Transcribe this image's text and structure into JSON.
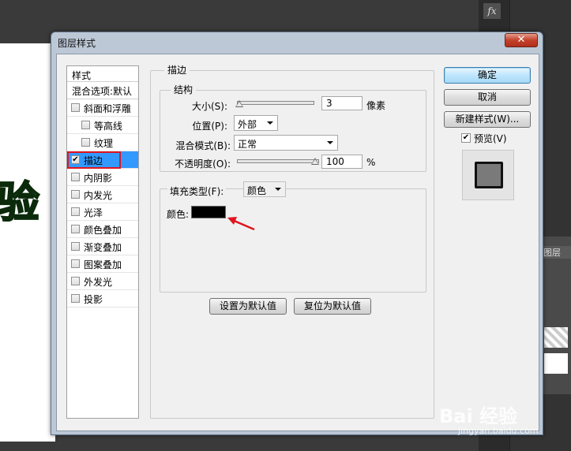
{
  "background": {
    "canvas_text": "验",
    "fx_label": "fx",
    "panel_tab": "图层",
    "watermark_logo": "Bai 经验",
    "watermark_url": "jingyan.baidu.com"
  },
  "dialog": {
    "title": "图层样式",
    "close_label": "✕"
  },
  "style_list": {
    "header": "样式",
    "blend_options": "混合选项:默认",
    "items": [
      {
        "label": "斜面和浮雕",
        "checked": false
      },
      {
        "label": "等高线",
        "checked": false
      },
      {
        "label": "纹理",
        "checked": false
      },
      {
        "label": "描边",
        "checked": true
      },
      {
        "label": "内阴影",
        "checked": false
      },
      {
        "label": "内发光",
        "checked": false
      },
      {
        "label": "光泽",
        "checked": false
      },
      {
        "label": "颜色叠加",
        "checked": false
      },
      {
        "label": "渐变叠加",
        "checked": false
      },
      {
        "label": "图案叠加",
        "checked": false
      },
      {
        "label": "外发光",
        "checked": false
      },
      {
        "label": "投影",
        "checked": false
      }
    ]
  },
  "stroke": {
    "section_title": "描边",
    "structure_title": "结构",
    "size_label": "大小(S):",
    "size_value": "3",
    "size_unit": "像素",
    "position_label": "位置(P):",
    "position_value": "外部",
    "blend_mode_label": "混合模式(B):",
    "blend_mode_value": "正常",
    "opacity_label": "不透明度(O):",
    "opacity_value": "100",
    "opacity_unit": "%",
    "fill_type_label": "填充类型(F):",
    "fill_type_value": "颜色",
    "color_label": "颜色:",
    "color_hex": "#000000",
    "set_default_label": "设置为默认值",
    "reset_default_label": "复位为默认值"
  },
  "actions": {
    "ok_label": "确定",
    "cancel_label": "取消",
    "new_style_label": "新建样式(W)...",
    "preview_label": "预览(V)",
    "preview_checked": true
  },
  "colors": {
    "selection": "#3399ff",
    "highlight_outline": "#e0141e",
    "annotation_arrow": "#e0141e"
  }
}
